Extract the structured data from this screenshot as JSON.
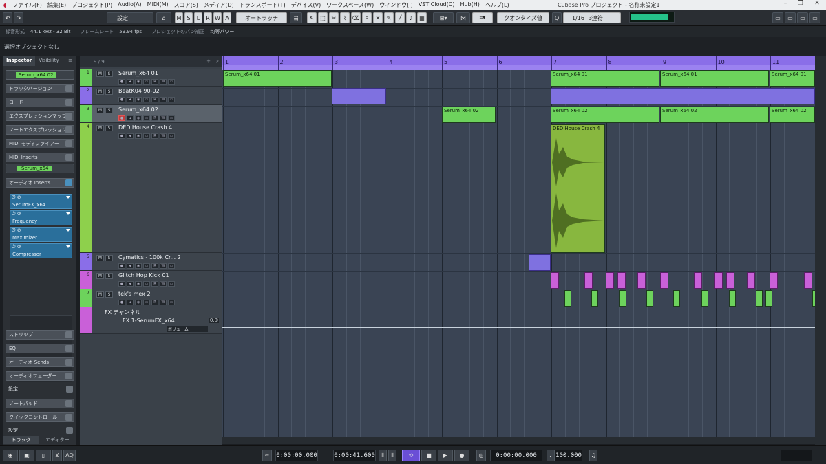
{
  "app": {
    "window_title": "Cubase Pro プロジェクト - 名称未設定1",
    "menu": [
      "ファイル(F)",
      "編集(E)",
      "プロジェクト(P)",
      "Audio(A)",
      "MIDI(M)",
      "スコア(S)",
      "メディア(D)",
      "トランスポート(T)",
      "デバイス(V)",
      "ワークスペース(W)",
      "ウィンドウ(I)",
      "VST Cloud(C)",
      "Hub(H)",
      "ヘルプ(L)"
    ]
  },
  "toolbar": {
    "settings_label": "設定",
    "modes": [
      "M",
      "S",
      "L",
      "R",
      "W",
      "A"
    ],
    "automation_label": "オートラッチ",
    "quantize_label": "クオンタイズ値",
    "grid_value": "1/16",
    "grid_mode": "3連符",
    "meter_level": 0.85
  },
  "infobar": {
    "sample_rate_label": "録音形式",
    "sample_rate": "44.1 kHz - 32 Bit",
    "frame_rate_label": "フレームレート",
    "frame_rate": "59.94 fps",
    "pan_label": "プロジェクトのパン補正",
    "pan_value": "均等パワー"
  },
  "selection_info": "選択オブジェクトなし",
  "inspector": {
    "tabs": [
      "Inspector",
      "Visibility"
    ],
    "track_name": "Serum_x64 02",
    "sections": [
      "トラックバージョン",
      "コード",
      "エクスプレッションマップ",
      "ノートエクスプレッション",
      "MIDI モディファイアー",
      "MIDI Inserts"
    ],
    "instrument": "Serum_x64",
    "audio_inserts": "オーディオ Inserts",
    "plugins": [
      "SerumFX_x64",
      "Frequency",
      "Maximizer",
      "Compressor"
    ],
    "lower_sections": [
      "ストリップ",
      "EQ",
      "オーディオ Sends",
      "オーディオフェーダー",
      "設定",
      "ノートパッド",
      "クイックコントロール",
      "設定"
    ],
    "bottom_tabs": [
      "トラック",
      "エディター"
    ]
  },
  "tracklist": {
    "counter": "9 / 9",
    "tracks": [
      {
        "num": "1",
        "name": "Serum_x64 01",
        "color": "#6dd35c"
      },
      {
        "num": "2",
        "name": "BeatK04 90-02",
        "color": "#8a6ee8"
      },
      {
        "num": "3",
        "name": "Serum_x64 02",
        "color": "#6dd35c"
      },
      {
        "num": "4",
        "name": "DED House Crash 4",
        "color": "#8ed04c"
      },
      {
        "num": "5",
        "name": "Cymatics - 100k Cr... 2",
        "color": "#8a6ee8"
      },
      {
        "num": "6",
        "name": "Glitch Hop Kick 01",
        "color": "#c960d8"
      },
      {
        "num": "7",
        "name": "tek's mex 2",
        "color": "#6dd35c"
      },
      {
        "num": "",
        "name": "FX チャンネル",
        "color": "#c960d8"
      },
      {
        "num": "",
        "name": "FX 1-SerumFX_x64",
        "color": "#c960d8"
      }
    ],
    "fx_volume": "0.0",
    "fx_route": "ボリューム"
  },
  "ruler": {
    "bars": [
      "1",
      "2",
      "3",
      "4",
      "5",
      "6",
      "7",
      "8",
      "9",
      "10",
      "11"
    ]
  },
  "events": {
    "serum1": "Serum_x64 01",
    "serum2": "Serum_x64 02",
    "crash": "DED House Crash 4"
  },
  "transport": {
    "left_locator": "0:00:00.000",
    "right_locator": "0:00:41.600",
    "position": "0:00:00.000",
    "tempo": "100.000"
  }
}
